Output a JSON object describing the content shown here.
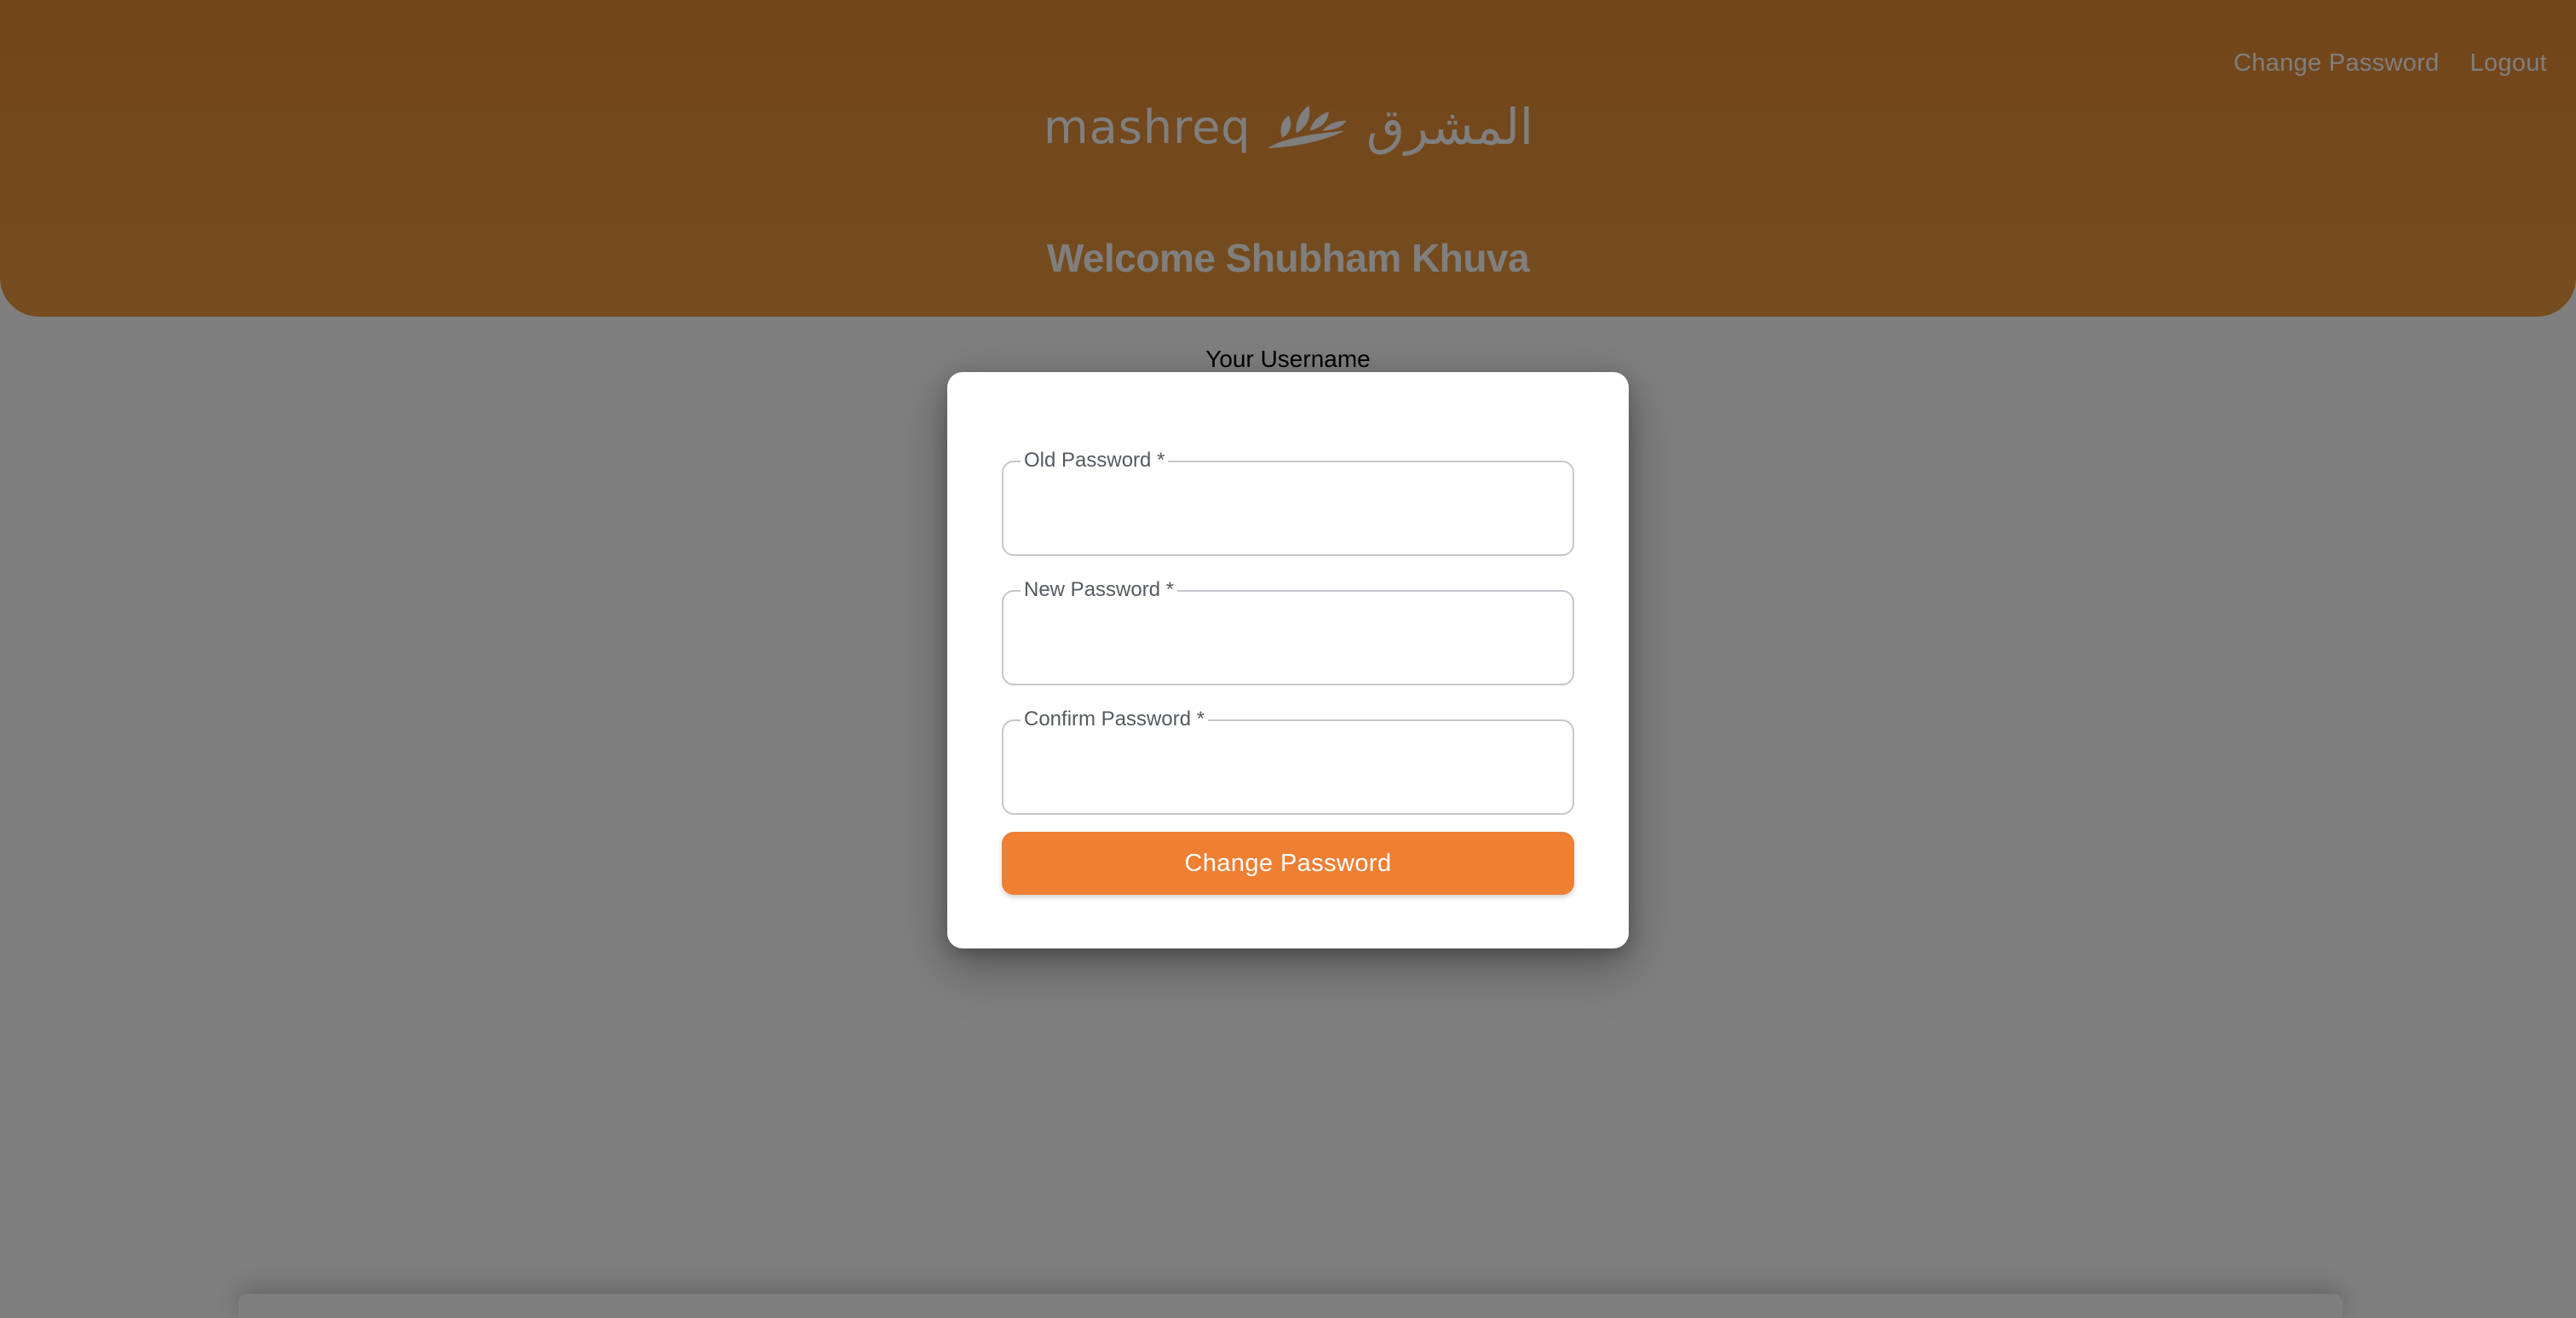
{
  "header": {
    "nav": {
      "change_password": "Change Password",
      "logout": "Logout"
    },
    "logo": {
      "latin": "mashreq",
      "arabic": "المشرق",
      "icon": "mashreq-flower-icon"
    },
    "welcome": "Welcome Shubham Khuva"
  },
  "main": {
    "username_label": "Your Username"
  },
  "dialog": {
    "fields": [
      {
        "label": "Old Password",
        "required_mark": "*",
        "value": ""
      },
      {
        "label": "New Password",
        "required_mark": "*",
        "value": ""
      },
      {
        "label": "Confirm Password",
        "required_mark": "*",
        "value": ""
      }
    ],
    "submit_label": "Change Password"
  },
  "colors": {
    "header_orange": "#e58a34",
    "button_orange": "#ee7f33",
    "backdrop": "rgba(0,0,0,0.5)"
  }
}
